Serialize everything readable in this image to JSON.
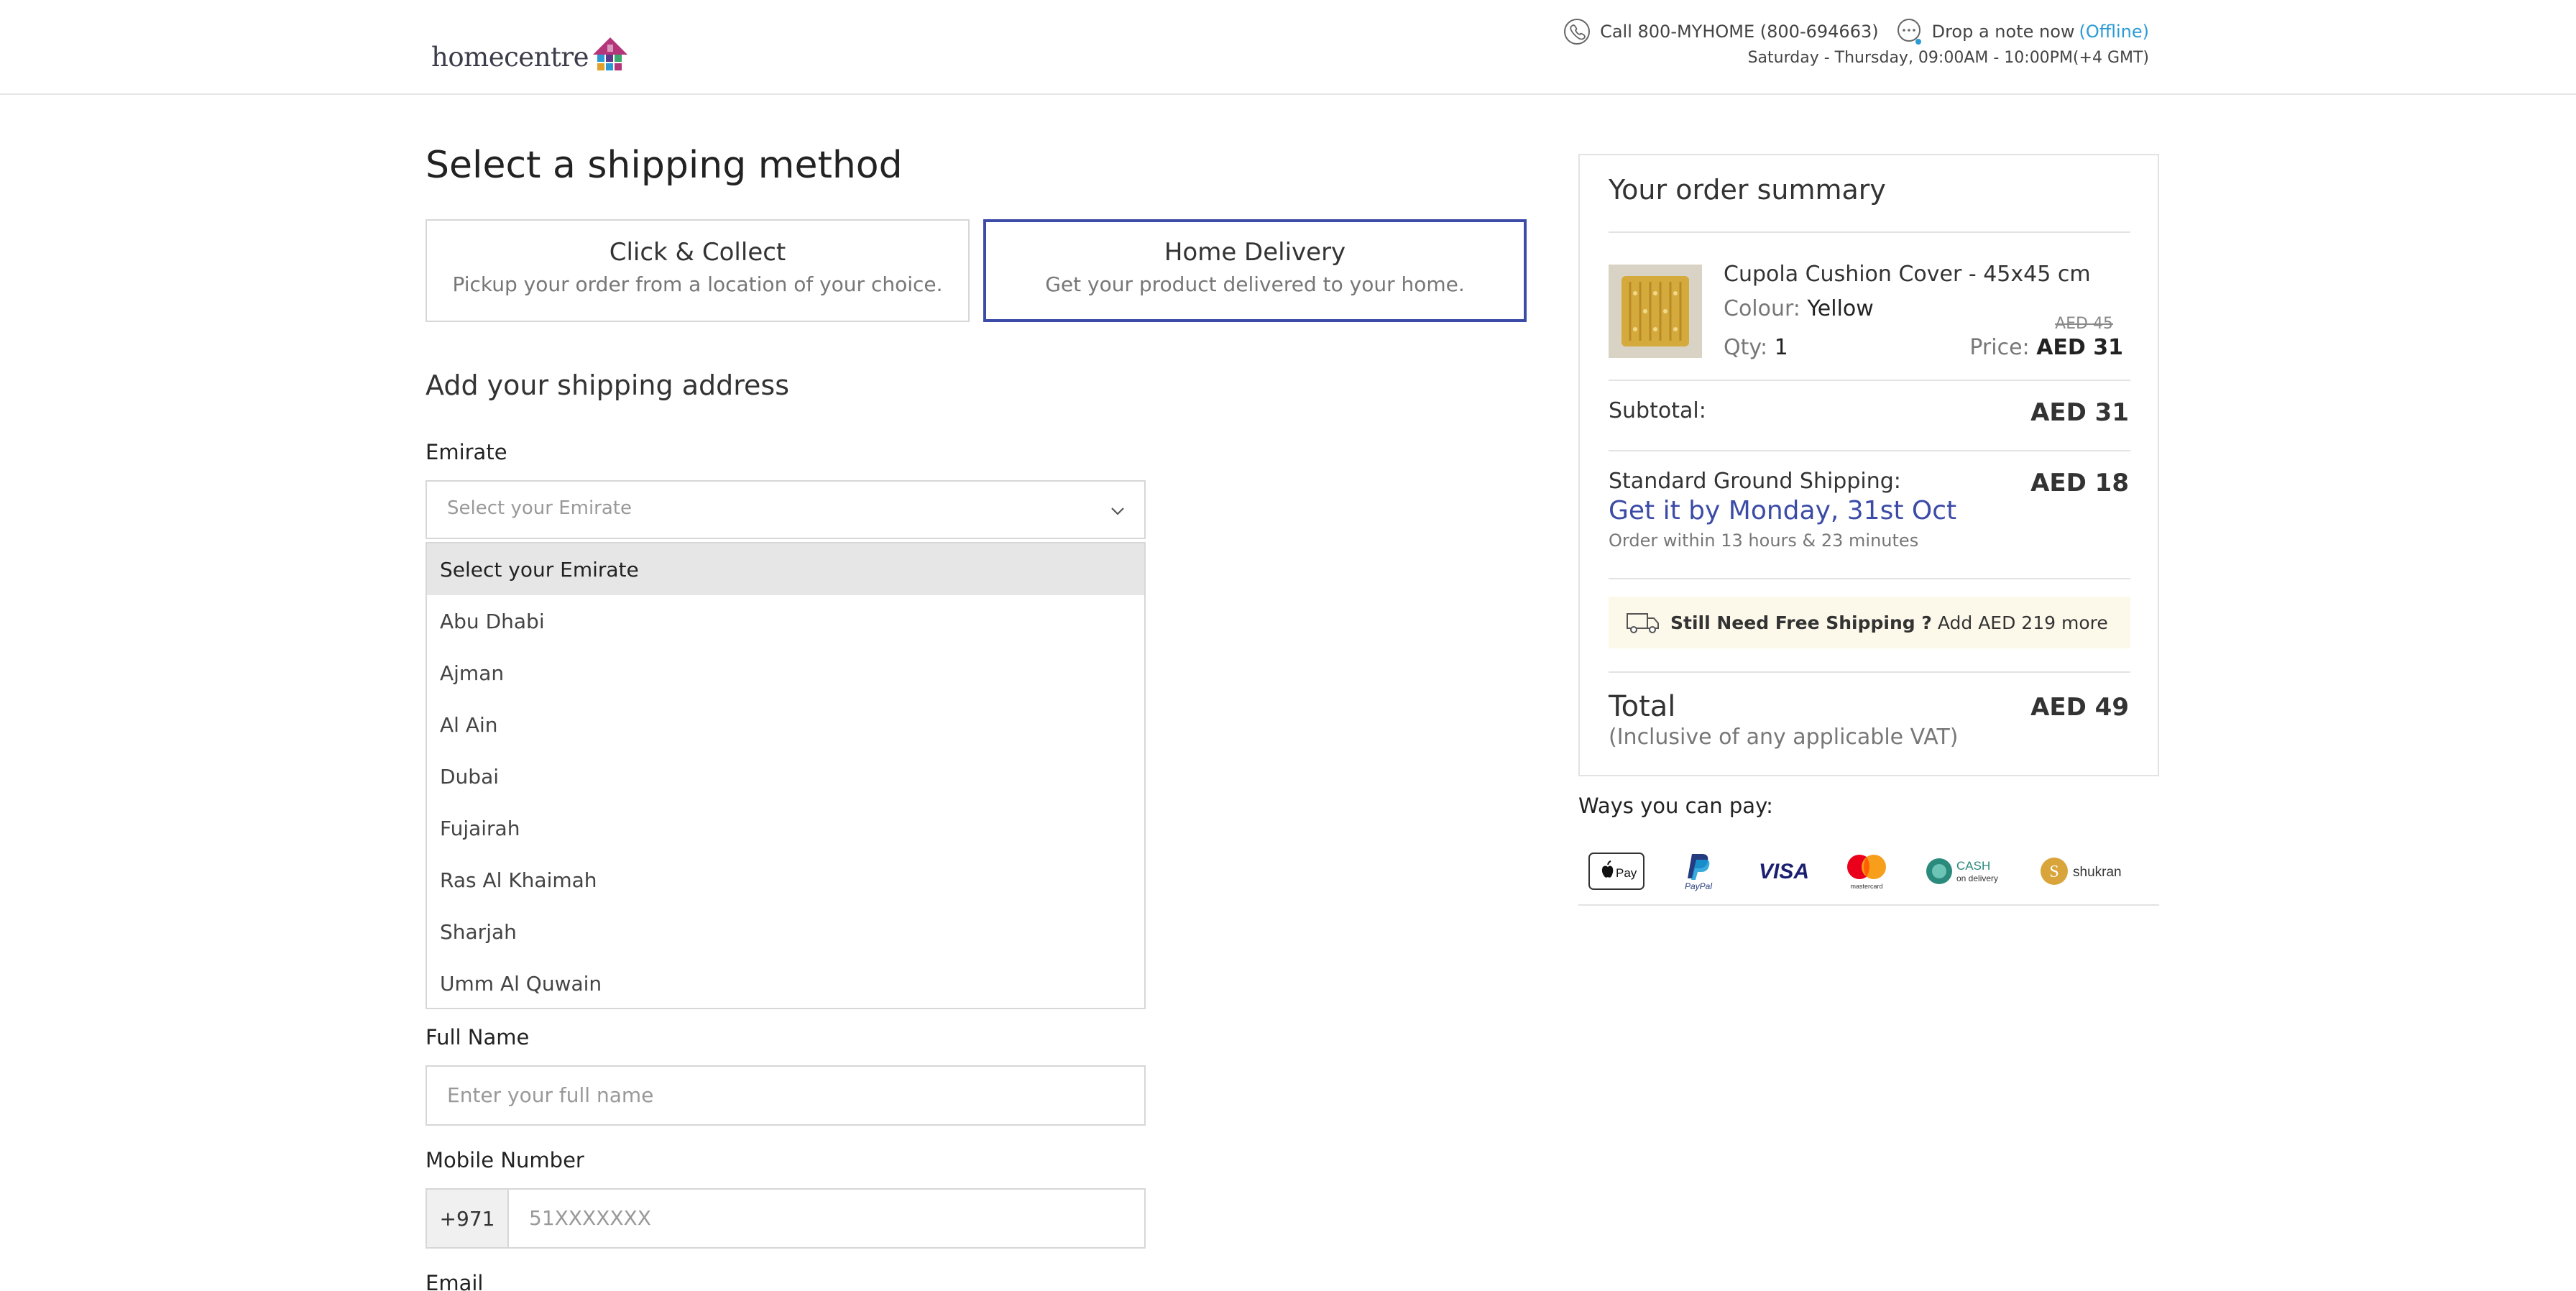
{
  "header": {
    "logo_text": "homecentre",
    "phone_label": "Call 800-MYHOME (800-694663)",
    "note_label": "Drop a note now",
    "note_status": "(Offline)",
    "hours": "Saturday - Thursday, 09:00AM - 10:00PM(+4 GMT)"
  },
  "shipping": {
    "title": "Select a shipping method",
    "options": [
      {
        "title": "Click & Collect",
        "subtitle": "Pickup your order from a location of your choice.",
        "selected": false
      },
      {
        "title": "Home Delivery",
        "subtitle": "Get your product delivered to your home.",
        "selected": true
      }
    ]
  },
  "address": {
    "title": "Add your shipping address",
    "emirate_label": "Emirate",
    "emirate_placeholder": "Select your Emirate",
    "emirate_options": [
      "Select your Emirate",
      "Abu Dhabi",
      "Ajman",
      "Al Ain",
      "Dubai",
      "Fujairah",
      "Ras Al Khaimah",
      "Sharjah",
      "Umm Al Quwain"
    ],
    "fullname_label": "Full Name",
    "fullname_placeholder": "Enter your full name",
    "mobile_label": "Mobile Number",
    "mobile_prefix": "+971",
    "mobile_placeholder": "51XXXXXXX",
    "email_label": "Email"
  },
  "summary": {
    "title": "Your order summary",
    "product": {
      "name": "Cupola Cushion Cover - 45x45 cm",
      "colour_label": "Colour:",
      "colour_value": "Yellow",
      "qty_label": "Qty:",
      "qty_value": "1",
      "old_price": "AED 45",
      "price_label": "Price:",
      "price_value": "AED 31"
    },
    "subtotal_label": "Subtotal:",
    "subtotal_value": "AED 31",
    "shipping_label": "Standard Ground Shipping:",
    "shipping_value": "AED 18",
    "delivery_date": "Get it by Monday, 31st Oct",
    "order_within": "Order within 13 hours & 23 minutes",
    "free_ship_bold": "Still Need Free Shipping ?",
    "free_ship_text": "Add AED 219 more",
    "total_label": "Total",
    "total_sub": "(Inclusive of any applicable VAT)",
    "total_value": "AED 49"
  },
  "payments": {
    "title": "Ways you can pay:",
    "methods": [
      "Pay",
      "PayPal",
      "VISA",
      "mastercard",
      "CASH",
      "on delivery",
      "shukran"
    ]
  },
  "colors": {
    "accent": "#3b4ba6",
    "link": "#2a9bd5",
    "border": "#d7d7d7"
  },
  "icons": [
    "phone-icon",
    "chat-icon",
    "chevron-down-icon",
    "truck-icon"
  ]
}
